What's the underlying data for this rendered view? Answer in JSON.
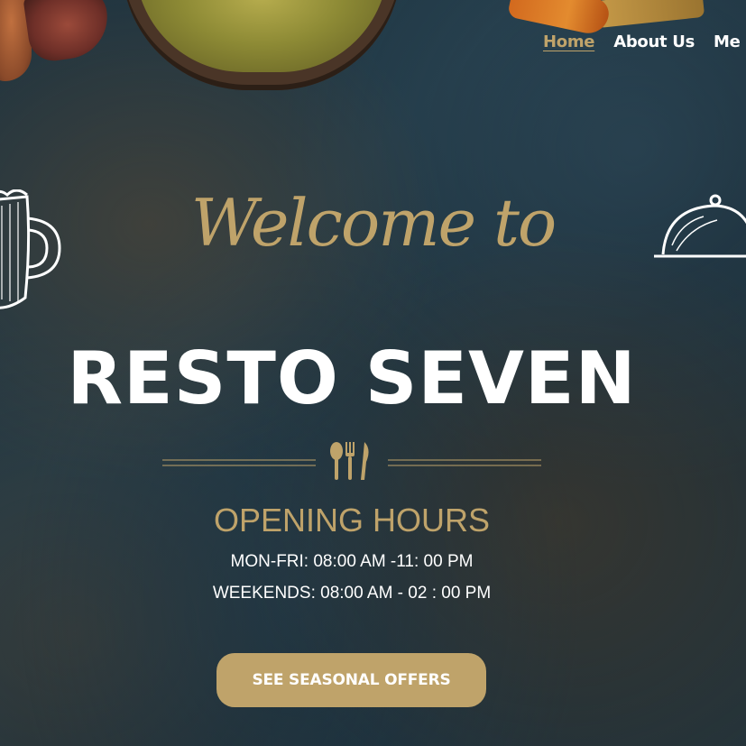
{
  "nav": {
    "items": [
      {
        "label": "Home",
        "active": true
      },
      {
        "label": "About Us",
        "active": false
      },
      {
        "label": "Me",
        "active": false
      }
    ]
  },
  "hero": {
    "welcome": "Welcome to",
    "brand": "RESTO SEVEN",
    "hours_title": "OPENING HOURS",
    "hours_weekdays": "MON-FRI: 08:00 AM -11: 00 PM",
    "hours_weekends": "WEEKENDS: 08:00 AM - 02 : 00 PM",
    "cta_label": "SEE SEASONAL OFFERS"
  },
  "colors": {
    "accent_gold": "#bfa36a",
    "text_white": "#ffffff",
    "background": "#1d3340"
  },
  "icons": [
    "beer-mug-icon",
    "food-cloche-icon",
    "cutlery-icon"
  ]
}
